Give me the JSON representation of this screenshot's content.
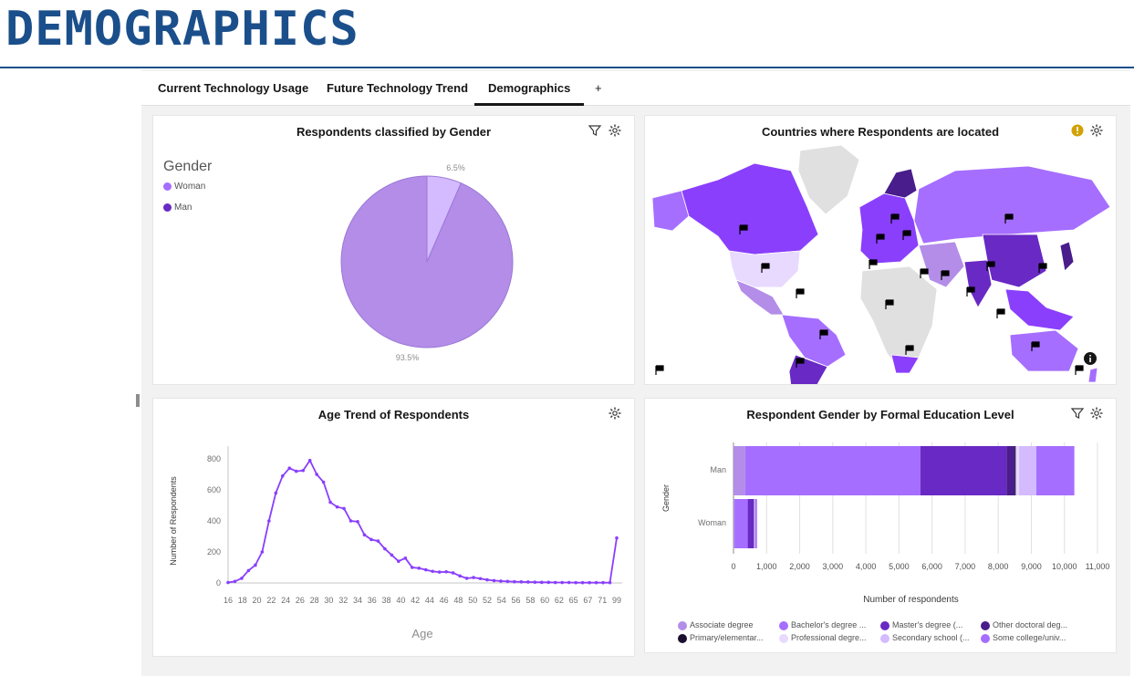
{
  "page_title": "DEMOGRAPHICS",
  "tabs": [
    {
      "label": "Current Technology Usage",
      "active": false
    },
    {
      "label": "Future Technology Trend",
      "active": false
    },
    {
      "label": "Demographics",
      "active": true
    },
    {
      "label": "+",
      "active": false
    }
  ],
  "colors": {
    "accent": "#1a4f8b",
    "purple_light": "#b38de8",
    "purple_mid": "#a56eff",
    "purple_dark": "#6929c4",
    "purple_darkest": "#31135e"
  },
  "gender_panel": {
    "title": "Respondents classified by Gender",
    "icons": [
      "filter-icon",
      "settings-icon"
    ],
    "legend_title": "Gender",
    "legend": [
      {
        "label": "Woman",
        "color": "#a56eff"
      },
      {
        "label": "Man",
        "color": "#6929c4"
      }
    ]
  },
  "map_panel": {
    "title": "Countries where Respondents are located",
    "icons": [
      "warning-icon",
      "settings-icon",
      "info-icon"
    ]
  },
  "age_panel": {
    "title": "Age Trend of Respondents",
    "icons": [
      "settings-icon"
    ]
  },
  "education_panel": {
    "title": "Respondent Gender by Formal Education Level",
    "icons": [
      "filter-icon",
      "settings-icon"
    ]
  },
  "chart_data": [
    {
      "type": "pie",
      "title": "Respondents classified by Gender",
      "legend_title": "Gender",
      "categories": [
        "Woman",
        "Man"
      ],
      "values": [
        6.5,
        93.5
      ],
      "data_labels": [
        "6.5%",
        "93.5%"
      ],
      "colors": [
        "#d4bbff",
        "#b38de8"
      ]
    },
    {
      "type": "line",
      "title": "Age Trend of Respondents",
      "xlabel": "Age",
      "ylabel": "Number of Respondents",
      "ylim": [
        0,
        800
      ],
      "yticks": [
        0,
        200,
        400,
        600,
        800
      ],
      "xticks": [
        "16",
        "18",
        "20",
        "22",
        "24",
        "26",
        "28",
        "30",
        "32",
        "34",
        "36",
        "38",
        "40",
        "42",
        "44",
        "46",
        "48",
        "50",
        "52",
        "54",
        "56",
        "58",
        "60",
        "62",
        "65",
        "67",
        "71",
        "99"
      ],
      "x": [
        16,
        17,
        18,
        19,
        20,
        21,
        22,
        23,
        24,
        25,
        26,
        27,
        28,
        29,
        30,
        31,
        32,
        33,
        34,
        35,
        36,
        37,
        38,
        39,
        40,
        41,
        42,
        43,
        44,
        45,
        46,
        47,
        48,
        49,
        50,
        51,
        52,
        53,
        54,
        55,
        56,
        57,
        58,
        59,
        60,
        61,
        62,
        63,
        64,
        65,
        66,
        67,
        68,
        69,
        70,
        71,
        72,
        99
      ],
      "values": [
        3,
        10,
        30,
        80,
        115,
        200,
        400,
        580,
        690,
        740,
        720,
        725,
        790,
        700,
        650,
        520,
        490,
        480,
        400,
        395,
        310,
        280,
        270,
        220,
        180,
        140,
        160,
        100,
        95,
        85,
        75,
        70,
        72,
        65,
        45,
        30,
        35,
        28,
        20,
        15,
        12,
        10,
        8,
        7,
        6,
        5,
        4,
        4,
        3,
        3,
        3,
        2,
        2,
        2,
        2,
        2,
        2,
        290
      ],
      "grid": false,
      "color": "#8a3ffc"
    },
    {
      "type": "bar",
      "orientation": "horizontal",
      "stacked": true,
      "title": "Respondent Gender by Formal Education Level",
      "xlabel": "Number of respondents",
      "ylabel": "Gender",
      "categories": [
        "Man",
        "Woman"
      ],
      "xlim": [
        0,
        11000
      ],
      "xticks": [
        "0",
        "1,000",
        "2,000",
        "3,000",
        "4,000",
        "5,000",
        "6,000",
        "7,000",
        "8,000",
        "9,000",
        "10,000",
        "11,000"
      ],
      "series": [
        {
          "name": "Associate degree",
          "values": [
            350,
            30
          ],
          "color": "#b38de8"
        },
        {
          "name": "Bachelor's degree ...",
          "values": [
            5300,
            400
          ],
          "color": "#a56eff"
        },
        {
          "name": "Master's degree (...",
          "values": [
            2600,
            180
          ],
          "color": "#6929c4"
        },
        {
          "name": "Other doctoral deg...",
          "values": [
            250,
            10
          ],
          "color": "#491d8b"
        },
        {
          "name": "Primary/elementar...",
          "values": [
            30,
            5
          ],
          "color": "#1c0f30"
        },
        {
          "name": "Professional degre...",
          "values": [
            100,
            10
          ],
          "color": "#e8daff"
        },
        {
          "name": "Secondary school (...",
          "values": [
            520,
            20
          ],
          "color": "#d4bbff"
        },
        {
          "name": "Some college/univ...",
          "values": [
            1150,
            55
          ],
          "color": "#a56eff"
        }
      ],
      "legend_placement": "bottom"
    }
  ]
}
